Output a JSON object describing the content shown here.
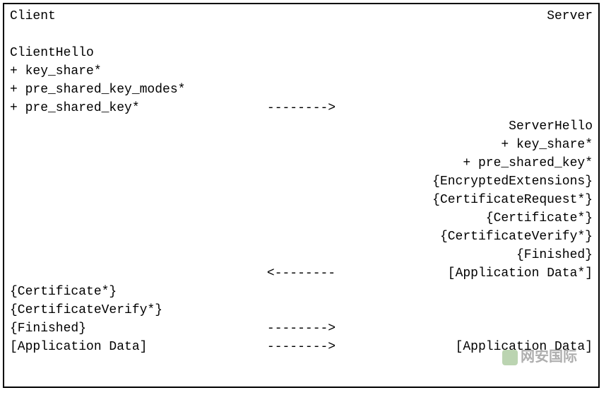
{
  "header": {
    "client_label": "Client",
    "server_label": "Server"
  },
  "client_hello": {
    "line1": "ClientHello",
    "line2": "+ key_share*",
    "line3": "+ pre_shared_key_modes*",
    "line4": "+ pre_shared_key*"
  },
  "arrows": {
    "right1": "-------->",
    "left1": "<--------",
    "right2": "-------->",
    "right3": "-------->"
  },
  "server_hello": {
    "line1": "ServerHello",
    "line2": "+ key_share*",
    "line3": "+ pre_shared_key*",
    "line4": "{EncryptedExtensions}",
    "line5": "{CertificateRequest*}",
    "line6": "{Certificate*}",
    "line7": "{CertificateVerify*}",
    "line8": "{Finished}",
    "line9": "[Application Data*]"
  },
  "client_finish": {
    "line1": "{Certificate*}",
    "line2": "{CertificateVerify*}",
    "line3": "{Finished}",
    "line4": "[Application Data]"
  },
  "server_finish": {
    "line1": "[Application Data]"
  },
  "watermark": {
    "text": "网安国际"
  }
}
